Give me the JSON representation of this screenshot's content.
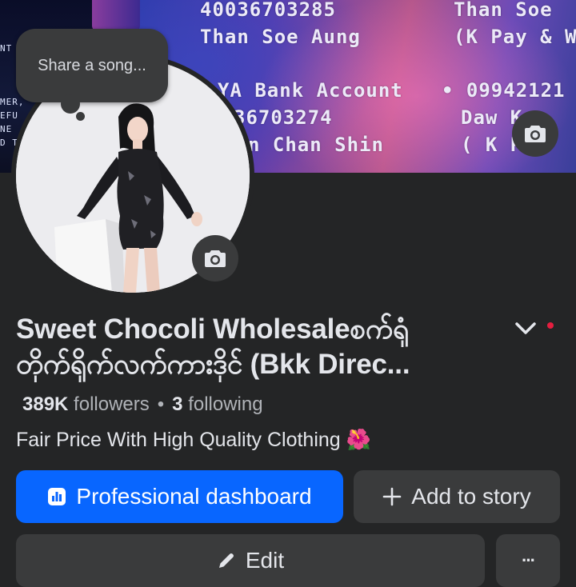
{
  "cover": {
    "side_text": [
      "NT",
      "MER,",
      "EFU",
      "NE",
      "D T"
    ],
    "lines": [
      "40036703285",
      "Than Soe Aung",
      "YA Bank Account",
      "36703274",
      "n Chan Shin",
      "Than Soe",
      "(K Pay & W",
      "• 09942121",
      "Daw K",
      "( K Pa"
    ],
    "camera_icon": "camera-icon"
  },
  "song_bubble": {
    "label": "Share a song..."
  },
  "profile": {
    "name_line1": "Sweet Chocoli Wholesaleစက်ရုံ",
    "name_line2": "တိုက်ရိုက်လက်ကားဒိုင် (Bkk Direc...",
    "followers_count": "389K",
    "followers_label": "followers",
    "separator": "•",
    "following_count": "3",
    "following_label": "following",
    "bio": "Fair Price With High Quality Clothing 🌺"
  },
  "buttons": {
    "dashboard": "Professional dashboard",
    "add_story": "Add to story",
    "edit": "Edit",
    "more": "···"
  },
  "colors": {
    "background": "#242526",
    "primary_button": "#0866ff",
    "secondary_button": "#3a3b3c",
    "notification_dot": "#e41e3f"
  }
}
